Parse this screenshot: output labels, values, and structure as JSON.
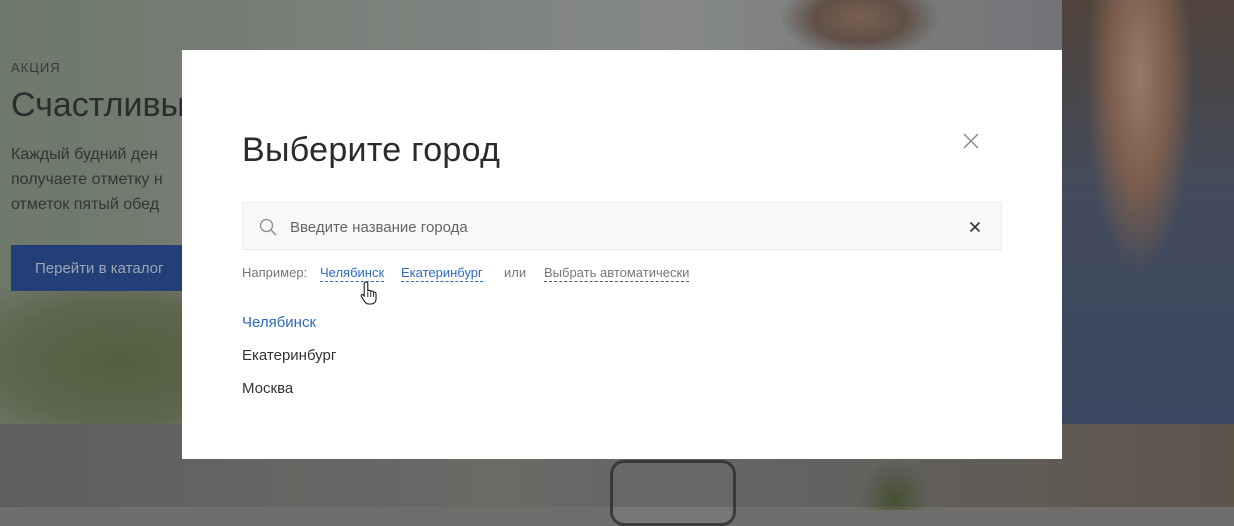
{
  "background": {
    "promo_label": "АКЦИЯ",
    "heading": "Счастливы",
    "description_lines": [
      "Каждый будний ден",
      "получаете отметку н",
      "отметок пятый обед"
    ],
    "catalog_button": "Перейти в каталог"
  },
  "modal": {
    "title": "Выберите город",
    "search": {
      "placeholder": "Введите название города",
      "value": ""
    },
    "examples": {
      "label": "Например:",
      "cities": [
        "Челябинск",
        "Екатеринбург"
      ],
      "or": "или",
      "auto": "Выбрать автоматически"
    },
    "cities": [
      {
        "name": "Челябинск",
        "active": true
      },
      {
        "name": "Екатеринбург",
        "active": false
      },
      {
        "name": "Москва",
        "active": false
      }
    ]
  },
  "colors": {
    "accent": "#2c6bc0",
    "catalog_button": "#21458a",
    "title_text": "#2b2b2b"
  },
  "icons": {
    "search": "search-icon",
    "close": "close-icon",
    "clear": "clear-icon",
    "cursor": "hand-cursor-icon"
  }
}
